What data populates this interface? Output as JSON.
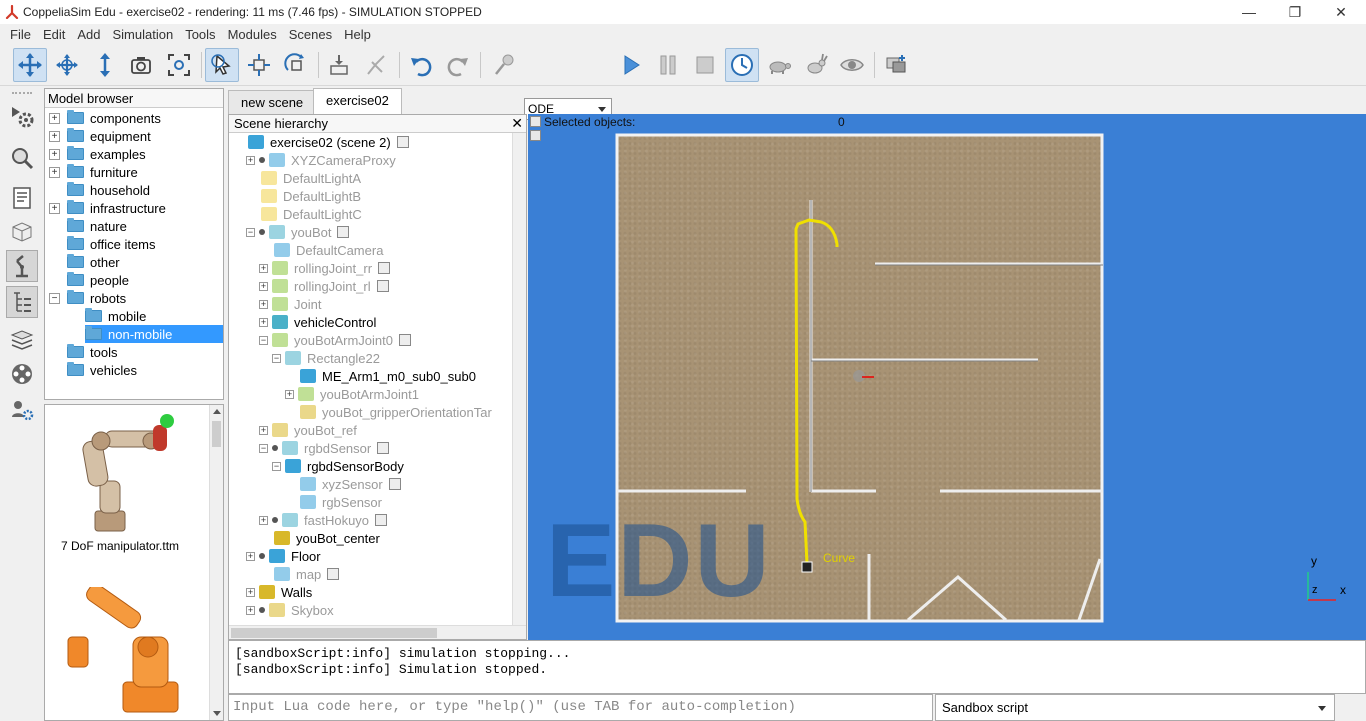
{
  "window": {
    "title": "CoppeliaSim Edu - exercise02 - rendering: 11 ms (7.46 fps) - SIMULATION STOPPED",
    "min": "—",
    "max": "❐",
    "close": "✕"
  },
  "menu": [
    "File",
    "Edit",
    "Add",
    "Simulation",
    "Tools",
    "Modules",
    "Scenes",
    "Help"
  ],
  "toolbar": {
    "engine": "ODE"
  },
  "model_browser": {
    "header": "Model browser",
    "items": [
      {
        "label": "components",
        "expand": "+",
        "depth": 0
      },
      {
        "label": "equipment",
        "expand": "+",
        "depth": 0
      },
      {
        "label": "examples",
        "expand": "+",
        "depth": 0
      },
      {
        "label": "furniture",
        "expand": "+",
        "depth": 0
      },
      {
        "label": "household",
        "expand": "",
        "depth": 0
      },
      {
        "label": "infrastructure",
        "expand": "+",
        "depth": 0
      },
      {
        "label": "nature",
        "expand": "",
        "depth": 0
      },
      {
        "label": "office items",
        "expand": "",
        "depth": 0
      },
      {
        "label": "other",
        "expand": "",
        "depth": 0
      },
      {
        "label": "people",
        "expand": "",
        "depth": 0
      },
      {
        "label": "robots",
        "expand": "−",
        "depth": 0
      },
      {
        "label": "mobile",
        "expand": "",
        "depth": 1
      },
      {
        "label": "non-mobile",
        "expand": "",
        "depth": 1,
        "selected": true
      },
      {
        "label": "tools",
        "expand": "",
        "depth": 0
      },
      {
        "label": "vehicles",
        "expand": "",
        "depth": 0
      }
    ],
    "thumbnail_caption": "7 DoF manipulator.ttm"
  },
  "tabs": [
    {
      "label": "new scene"
    },
    {
      "label": "exercise02",
      "active": true
    }
  ],
  "hierarchy": {
    "header": "Scene hierarchy",
    "close": "✕",
    "rows": [
      {
        "label": "exercise02 (scene 2)",
        "indent": 0,
        "exp": "",
        "dim": false,
        "icon": "#3aa3d8",
        "script": true
      },
      {
        "label": "XYZCameraProxy",
        "indent": 1,
        "exp": "+",
        "dim": true,
        "icon": "#3aa3d8",
        "dot": true
      },
      {
        "label": "DefaultLightA",
        "indent": 1,
        "exp": "",
        "dim": true,
        "icon": "#f0d24a"
      },
      {
        "label": "DefaultLightB",
        "indent": 1,
        "exp": "",
        "dim": true,
        "icon": "#f0d24a"
      },
      {
        "label": "DefaultLightC",
        "indent": 1,
        "exp": "",
        "dim": true,
        "icon": "#f0d24a"
      },
      {
        "label": "youBot",
        "indent": 1,
        "exp": "−",
        "dim": true,
        "icon": "#4ab0c8",
        "dot": true,
        "script": true
      },
      {
        "label": "DefaultCamera",
        "indent": 2,
        "exp": "",
        "dim": true,
        "icon": "#3aa3d8"
      },
      {
        "label": "rollingJoint_rr",
        "indent": 2,
        "exp": "+",
        "dim": true,
        "icon": "#8cc63f",
        "script": true
      },
      {
        "label": "rollingJoint_rl",
        "indent": 2,
        "exp": "+",
        "dim": true,
        "icon": "#8cc63f",
        "script": true
      },
      {
        "label": "Joint",
        "indent": 2,
        "exp": "+",
        "dim": true,
        "icon": "#8cc63f"
      },
      {
        "label": "vehicleControl",
        "indent": 2,
        "exp": "+",
        "dim": false,
        "icon": "#4ab0c8"
      },
      {
        "label": "youBotArmJoint0",
        "indent": 2,
        "exp": "−",
        "dim": true,
        "icon": "#8cc63f",
        "script": true
      },
      {
        "label": "Rectangle22",
        "indent": 3,
        "exp": "−",
        "dim": true,
        "icon": "#4ab0c8"
      },
      {
        "label": "ME_Arm1_m0_sub0_sub0",
        "indent": 4,
        "exp": "",
        "dim": false,
        "icon": "#3aa3d8"
      },
      {
        "label": "youBotArmJoint1",
        "indent": 4,
        "exp": "+",
        "dim": true,
        "icon": "#8cc63f"
      },
      {
        "label": "youBot_gripperOrientationTar",
        "indent": 4,
        "exp": "",
        "dim": true,
        "icon": "#d8b82a"
      },
      {
        "label": "youBot_ref",
        "indent": 2,
        "exp": "+",
        "dim": true,
        "icon": "#d8b82a"
      },
      {
        "label": "rgbdSensor",
        "indent": 2,
        "exp": "−",
        "dim": true,
        "icon": "#4ab0c8",
        "dot": true,
        "script": true
      },
      {
        "label": "rgbdSensorBody",
        "indent": 3,
        "exp": "−",
        "dim": false,
        "icon": "#3aa3d8"
      },
      {
        "label": "xyzSensor",
        "indent": 4,
        "exp": "",
        "dim": true,
        "icon": "#3aa3d8",
        "script": true
      },
      {
        "label": "rgbSensor",
        "indent": 4,
        "exp": "",
        "dim": true,
        "icon": "#3aa3d8"
      },
      {
        "label": "fastHokuyo",
        "indent": 2,
        "exp": "+",
        "dim": true,
        "icon": "#4ab0c8",
        "dot": true,
        "script": true
      },
      {
        "label": "youBot_center",
        "indent": 2,
        "exp": "",
        "dim": false,
        "icon": "#d8b82a"
      },
      {
        "label": "Floor",
        "indent": 1,
        "exp": "+",
        "dim": false,
        "icon": "#3aa3d8",
        "dot": true
      },
      {
        "label": "map",
        "indent": 2,
        "exp": "",
        "dim": true,
        "icon": "#3aa3d8",
        "script": true
      },
      {
        "label": "Walls",
        "indent": 1,
        "exp": "+",
        "dim": false,
        "icon": "#d8b82a"
      },
      {
        "label": "Skybox",
        "indent": 1,
        "exp": "+",
        "dim": true,
        "icon": "#d8b82a",
        "dot": true
      }
    ]
  },
  "viewport": {
    "selected_label": "Selected objects:",
    "selected_count": "0",
    "watermark": "EDU",
    "curve_label": "Curve",
    "axis_y": "y",
    "axis_z": "z",
    "axis_x": "x",
    "background": "#3a7fd5"
  },
  "console": {
    "lines": [
      "[sandboxScript:info] simulation stopping...",
      "[sandboxScript:info] Simulation stopped."
    ]
  },
  "input": {
    "placeholder": "Input Lua code here, or type \"help()\" (use TAB for auto-completion)"
  },
  "script_select": {
    "value": "Sandbox script"
  }
}
